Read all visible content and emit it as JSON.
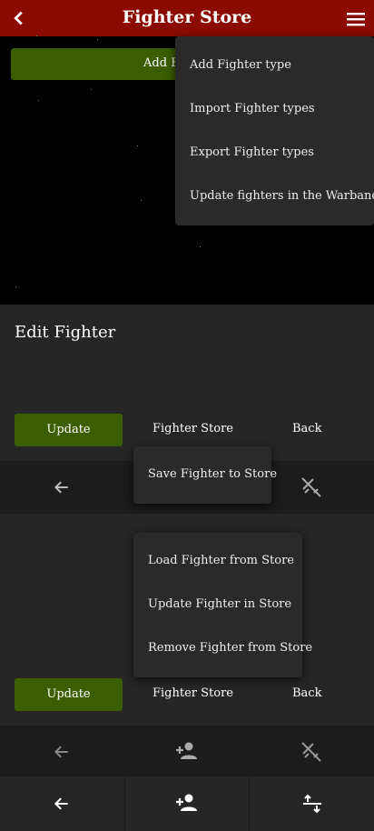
{
  "header": {
    "title": "Fighter Store"
  },
  "background": {
    "button_partial": "Add Fi"
  },
  "top_menu": {
    "items": [
      "Add Fighter type",
      "Import Fighter types",
      "Export Fighter types",
      "Update fighters in the Warbands"
    ]
  },
  "edit_card": {
    "title": "Edit Fighter",
    "update_label": "Update",
    "store_label": "Fighter Store",
    "back_label": "Back"
  },
  "save_menu": {
    "items": [
      "Save Fighter to Store"
    ]
  },
  "store_menu": {
    "items": [
      "Load Fighter from Store",
      "Update Fighter in Store",
      "Remove Fighter from Store"
    ]
  },
  "lower_card": {
    "update_label": "Update",
    "store_label": "Fighter Store",
    "back_label": "Back"
  },
  "icons": {
    "back": "arrow-left-icon",
    "add_person": "person-add-icon",
    "swords_off": "swords-off-icon",
    "swap": "swap-vertical-icon",
    "menu": "hamburger-menu-icon"
  },
  "colors": {
    "header": "#8b0b00",
    "accent_green": "#3b5e00",
    "surface": "#262626"
  }
}
